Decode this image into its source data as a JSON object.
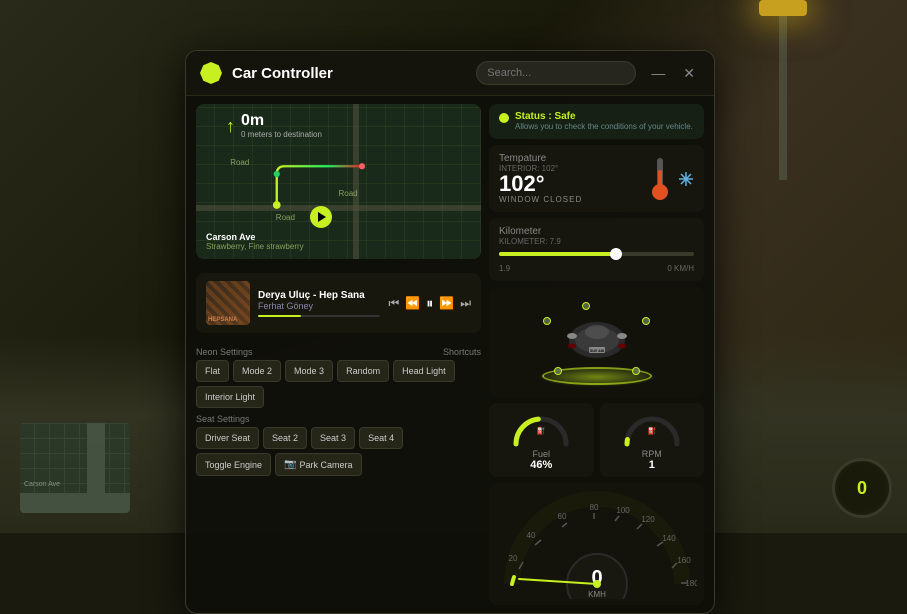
{
  "background": {
    "color": "#1a1a0f"
  },
  "window": {
    "title": "Car Controller",
    "search_placeholder": "Search...",
    "minimize_btn": "—",
    "close_btn": "✕"
  },
  "map": {
    "distance": "0m",
    "distance_sub": "0 meters to destination",
    "labels": [
      "Road",
      "Road",
      "Road"
    ],
    "address": "Carson Ave",
    "address_sub": "Strawberry, Fine strawberry"
  },
  "temperature": {
    "label": "Tempature",
    "interior_label": "INTERIOR: 102°",
    "value": "102°",
    "unit": "o",
    "status": "WINDOW CLOSED"
  },
  "kilometer": {
    "label": "Kilometer",
    "sub_label": "KILOMETER: 7.9",
    "val_left": "1.9",
    "val_right": "0 KM/H"
  },
  "status": {
    "label": "Status : Safe",
    "description": "Allows you to check the conditions of your vehicle."
  },
  "music": {
    "title": "Derya Uluç - Hep Sana",
    "artist": "Ferhat Göney",
    "progress_pct": 35
  },
  "music_controls": {
    "prev": "⏮",
    "rewind": "⏪",
    "play": "⏸",
    "forward": "⏩",
    "next": "⏭"
  },
  "neon_settings": {
    "label": "Neon Settings",
    "buttons": [
      "Flat",
      "Mode 2",
      "Mode 3",
      "Random"
    ]
  },
  "shortcuts": {
    "label": "Shortcuts",
    "buttons": [
      "Head Light",
      "Interior Light"
    ]
  },
  "seat_settings": {
    "label": "Seat Settings",
    "buttons": [
      "Driver Seat",
      "Seat 2",
      "Seat 3",
      "Seat 4",
      "Toggle Engine"
    ]
  },
  "park_camera": {
    "label": "Park Camera"
  },
  "fuel": {
    "label": "Fuel",
    "value": "46%",
    "arc_pct": 46
  },
  "rpm": {
    "label": "RPM",
    "value": "1",
    "arc_pct": 5
  },
  "speedometer": {
    "value": "0",
    "unit": "KMH",
    "min": 0,
    "max": 180,
    "labels": [
      "20",
      "40",
      "60",
      "80",
      "100",
      "120",
      "140",
      "160",
      "180"
    ]
  }
}
